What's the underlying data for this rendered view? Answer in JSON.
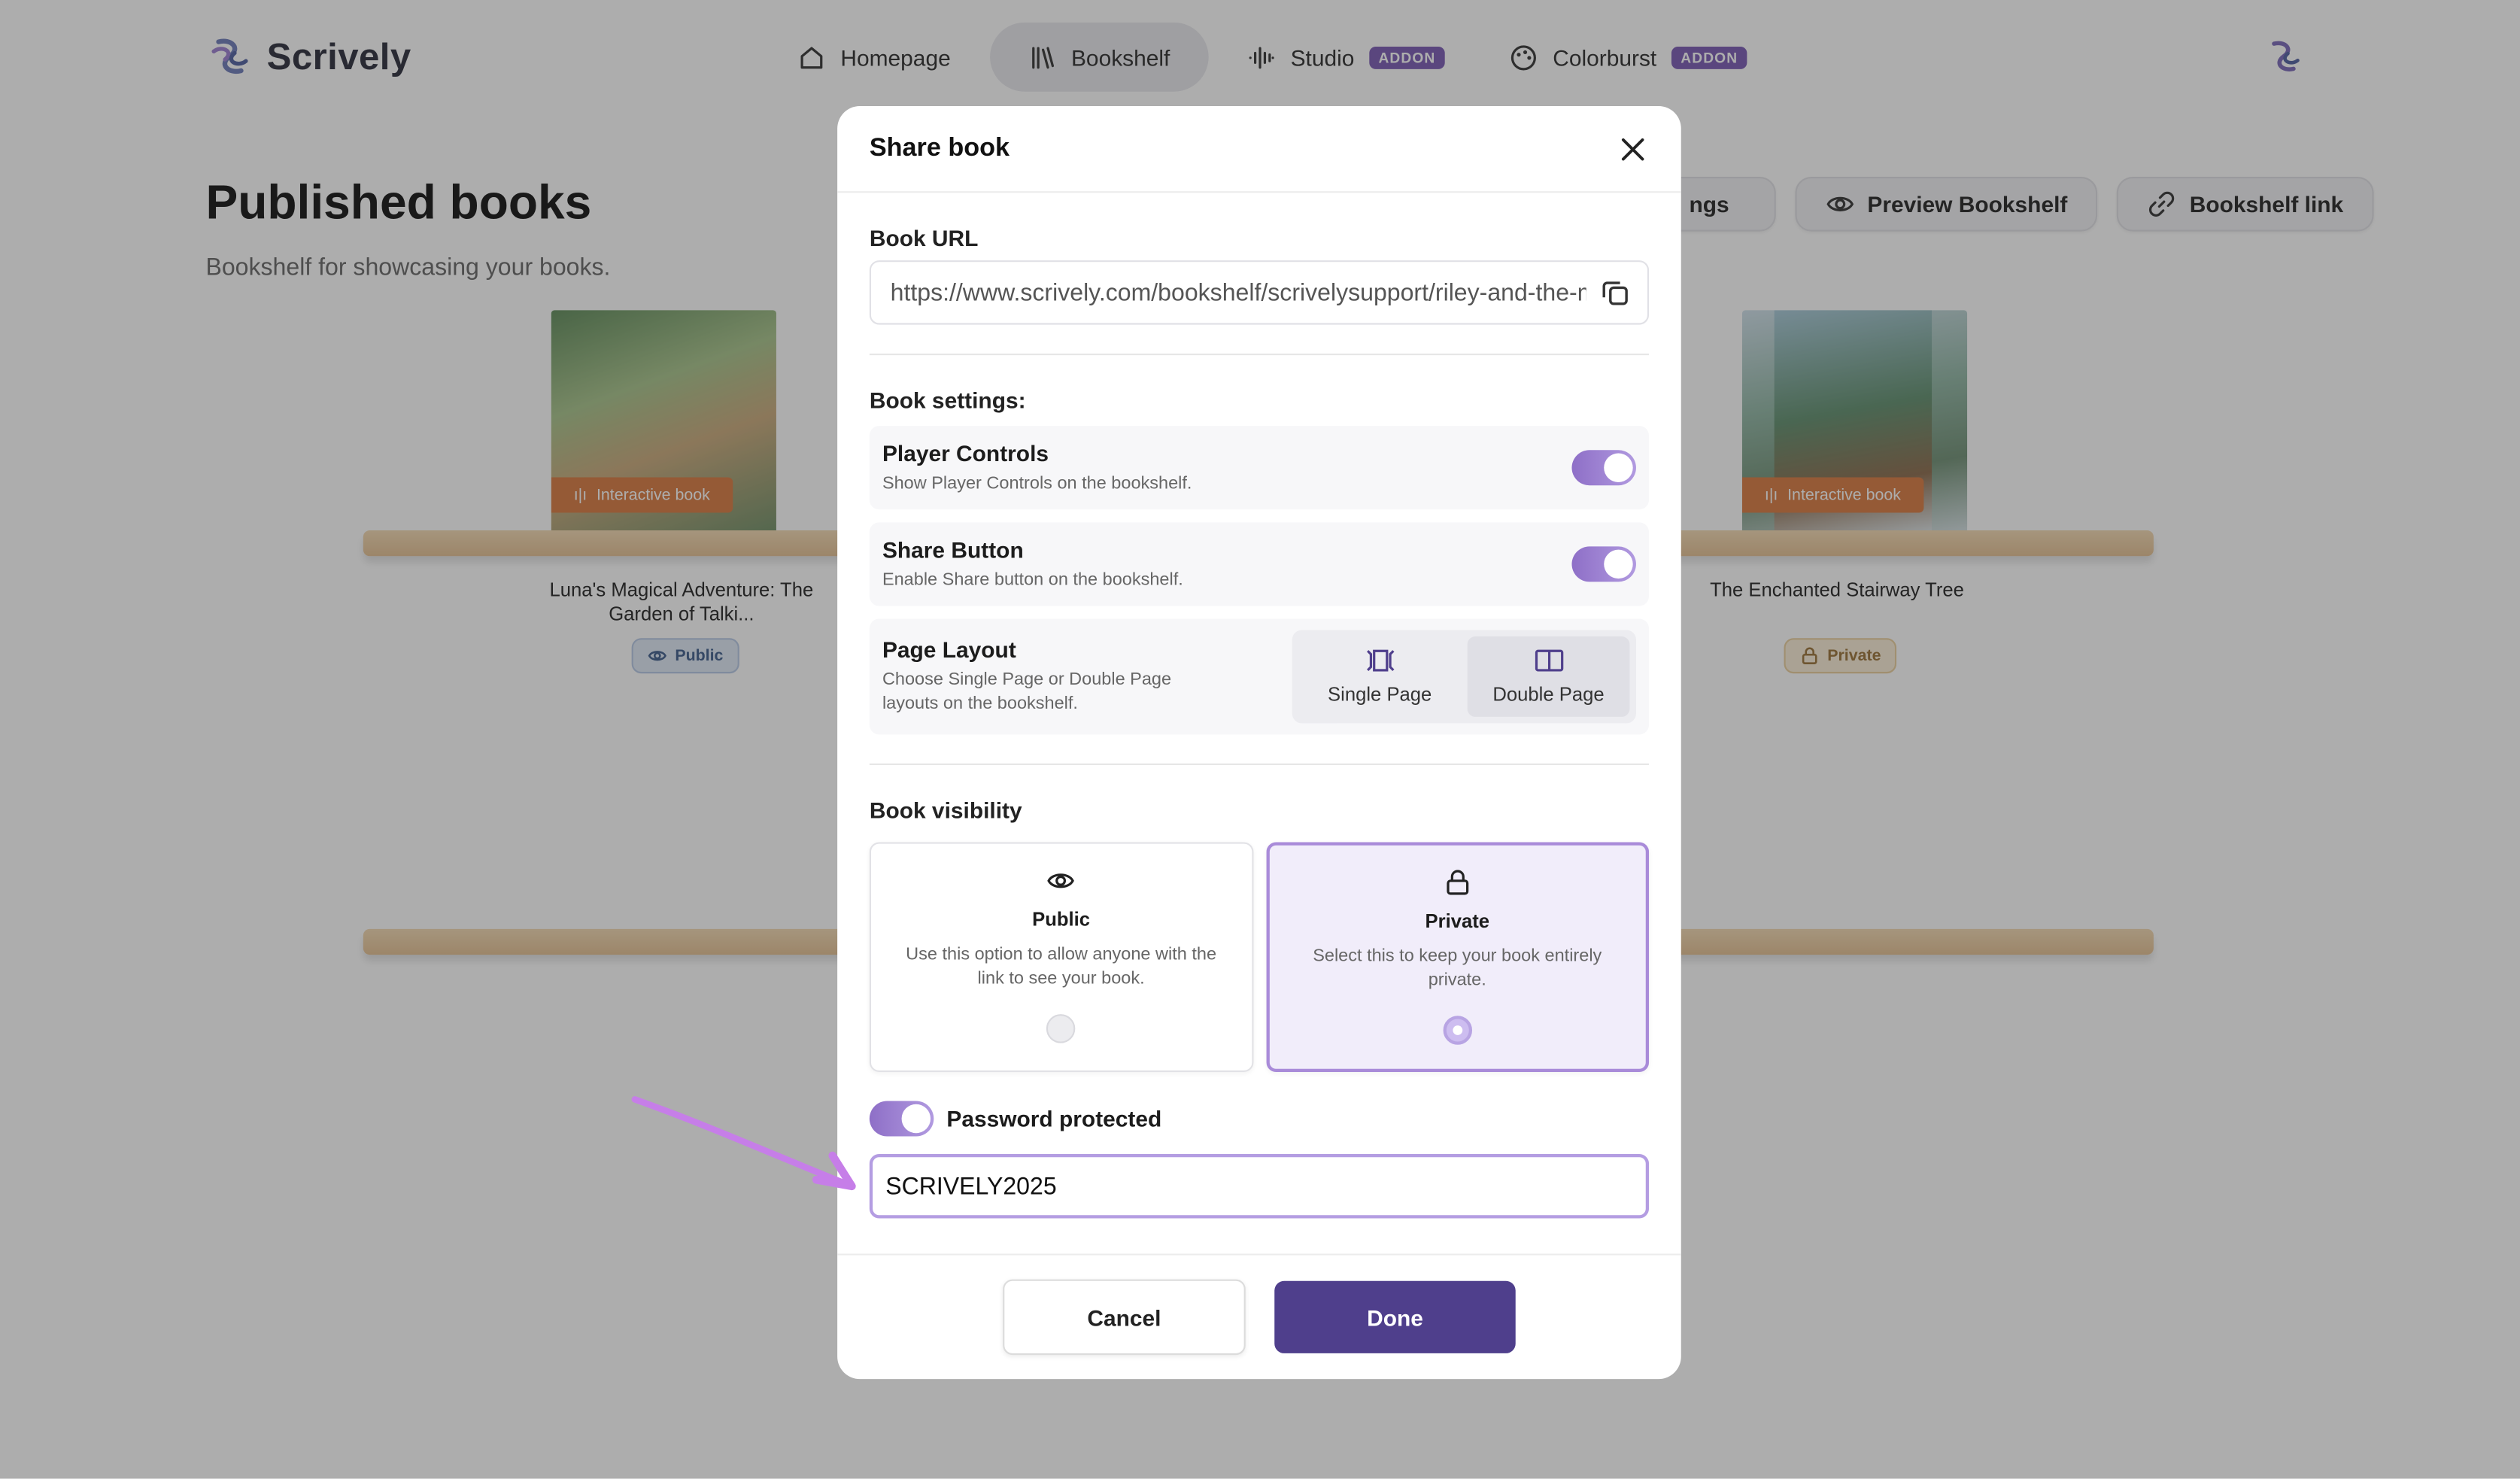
{
  "brand": {
    "name": "Scrively"
  },
  "nav": {
    "items": [
      {
        "label": "Homepage",
        "icon": "home-icon"
      },
      {
        "label": "Bookshelf",
        "icon": "library-icon",
        "active": true
      },
      {
        "label": "Studio",
        "icon": "audio-wave-icon",
        "badge": "ADDON"
      },
      {
        "label": "Colorburst",
        "icon": "palette-icon",
        "badge": "ADDON"
      }
    ]
  },
  "page": {
    "title": "Published books",
    "subtitle": "Bookshelf for showcasing your books.",
    "actions": {
      "settings_partial": "ngs",
      "preview": "Preview Bookshelf",
      "link": "Bookshelf link"
    }
  },
  "books": [
    {
      "title": "Luna's Magical Adventure: The Garden of Talki...",
      "tag": "Interactive book",
      "visibility": "Public"
    },
    {
      "title": "The Enchanted Stairway Tree",
      "tag": "Interactive book",
      "visibility": "Private"
    }
  ],
  "modal": {
    "title": "Share book",
    "url_label": "Book URL",
    "url_value": "https://www.scrively.com/bookshelf/scrivelysupport/riley-and-the-m",
    "settings_label": "Book settings:",
    "player_controls": {
      "name": "Player Controls",
      "desc": "Show Player Controls on the bookshelf.",
      "enabled": true
    },
    "share_button": {
      "name": "Share Button",
      "desc": "Enable Share button on the bookshelf.",
      "enabled": true
    },
    "page_layout": {
      "name": "Page Layout",
      "desc": "Choose Single Page or Double Page layouts on the bookshelf.",
      "single": "Single Page",
      "double": "Double Page",
      "selected": "Double Page"
    },
    "visibility_label": "Book visibility",
    "public": {
      "title": "Public",
      "desc": "Use this option to allow anyone with the link to see your book."
    },
    "private": {
      "title": "Private",
      "desc": "Select this to keep your book entirely private."
    },
    "selected_visibility": "Private",
    "password_label": "Password protected",
    "password_enabled": true,
    "password_value": "SCRIVELY2025",
    "cancel": "Cancel",
    "done": "Done"
  },
  "colors": {
    "accent": "#4f3f8c",
    "toggle": "#8e6fc7",
    "selected_border": "#a98bd9",
    "arrow": "#c67ee8",
    "addon_badge": "#7a5ab3"
  }
}
